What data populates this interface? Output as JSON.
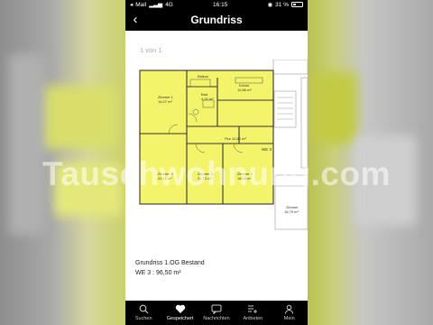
{
  "status_bar": {
    "carrier": "Mail",
    "network": "4G",
    "time": "16:15",
    "battery": "31 %",
    "battery_level": 0.31
  },
  "nav": {
    "title": "Grundriss",
    "back_icon": "chevron-left-icon"
  },
  "viewer": {
    "pager": "1 von 1"
  },
  "floor_plan": {
    "highlight_color": "#f4f46b",
    "rooms": [
      {
        "name": "Zimmer 1",
        "area": "14,07 m²"
      },
      {
        "name": "Balkon",
        "area": ""
      },
      {
        "name": "Bad",
        "area": "4,32 m²"
      },
      {
        "name": "Küche",
        "area": "10,86 m²"
      },
      {
        "name": "Flur",
        "area": "10,80 m²"
      },
      {
        "name": "Zimmer 2",
        "area": "22,11 m²"
      },
      {
        "name": "Zimmer 3",
        "area": "21,72 m²"
      },
      {
        "name": "Zimmer 4",
        "area": "18,02 m²"
      },
      {
        "name": "Zimmer",
        "area": "16,79 m²"
      }
    ],
    "unit_label": "WE 3"
  },
  "caption": {
    "line1": "Grundriss 1.OG Bestand",
    "line2": "WE 3 : 96,50 m²"
  },
  "tabs": [
    {
      "label": "Suchen",
      "icon": "search-icon",
      "active": false
    },
    {
      "label": "Gespeichert",
      "icon": "heart-icon",
      "active": true
    },
    {
      "label": "Nachrichten",
      "icon": "chat-bubble-icon",
      "active": false
    },
    {
      "label": "Anbieten",
      "icon": "list-add-icon",
      "active": false
    },
    {
      "label": "Mein",
      "icon": "user-icon",
      "active": false
    }
  ],
  "watermark": "Tauschwohnung.com"
}
